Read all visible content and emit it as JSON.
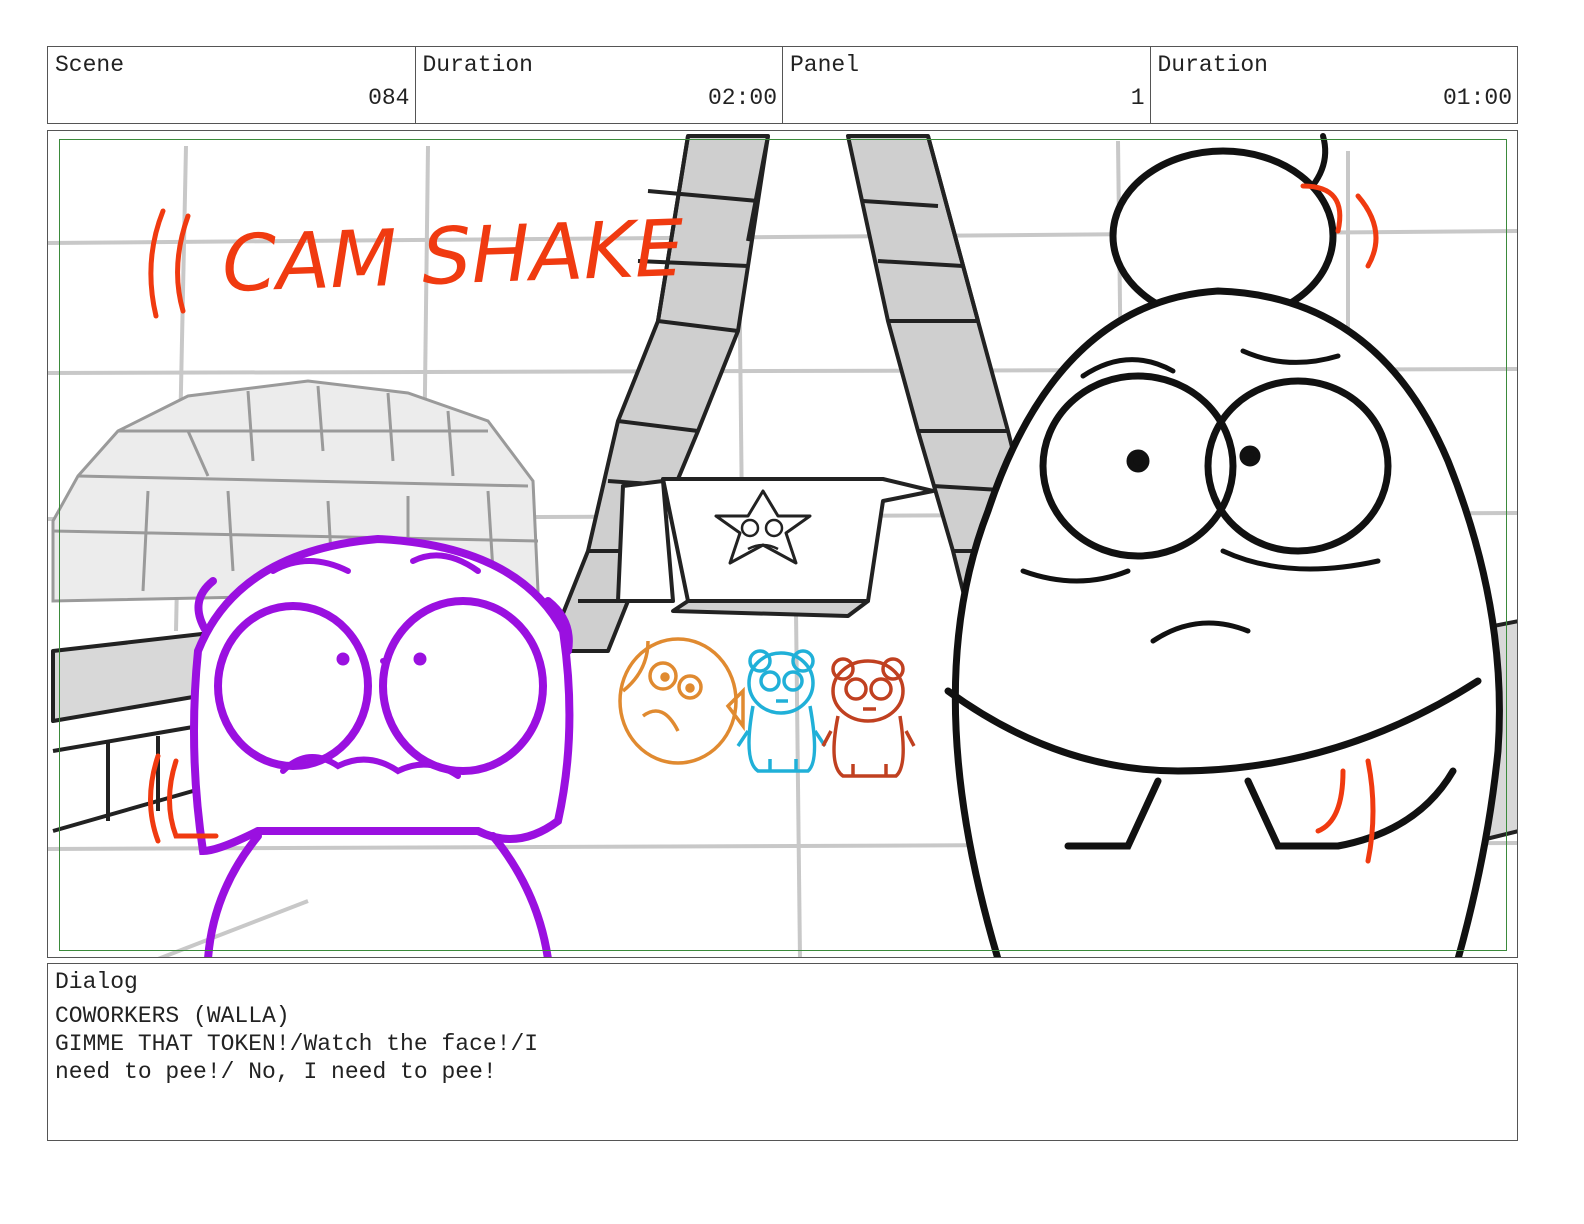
{
  "header": {
    "scene_label": "Scene",
    "scene_value": "084",
    "duration_label": "Duration",
    "duration_value": "02:00",
    "panel_label": "Panel",
    "panel_value": "1",
    "panel_duration_label": "Duration",
    "panel_duration_value": "01:00"
  },
  "panel": {
    "annotation": "CAM SHAKE",
    "colors": {
      "annotation": "#f03a10",
      "purple_character": "#9a10e0",
      "orange_character": "#e08a30",
      "cyan_character": "#20b0d8",
      "rust_character": "#c04020",
      "safe_frame": "#3b8a3b"
    }
  },
  "dialog": {
    "label": "Dialog",
    "lines": [
      "COWORKERS (WALLA)",
      "GIMME THAT TOKEN!/Watch the face!/I",
      "need to pee!/ No, I need to pee!"
    ]
  }
}
